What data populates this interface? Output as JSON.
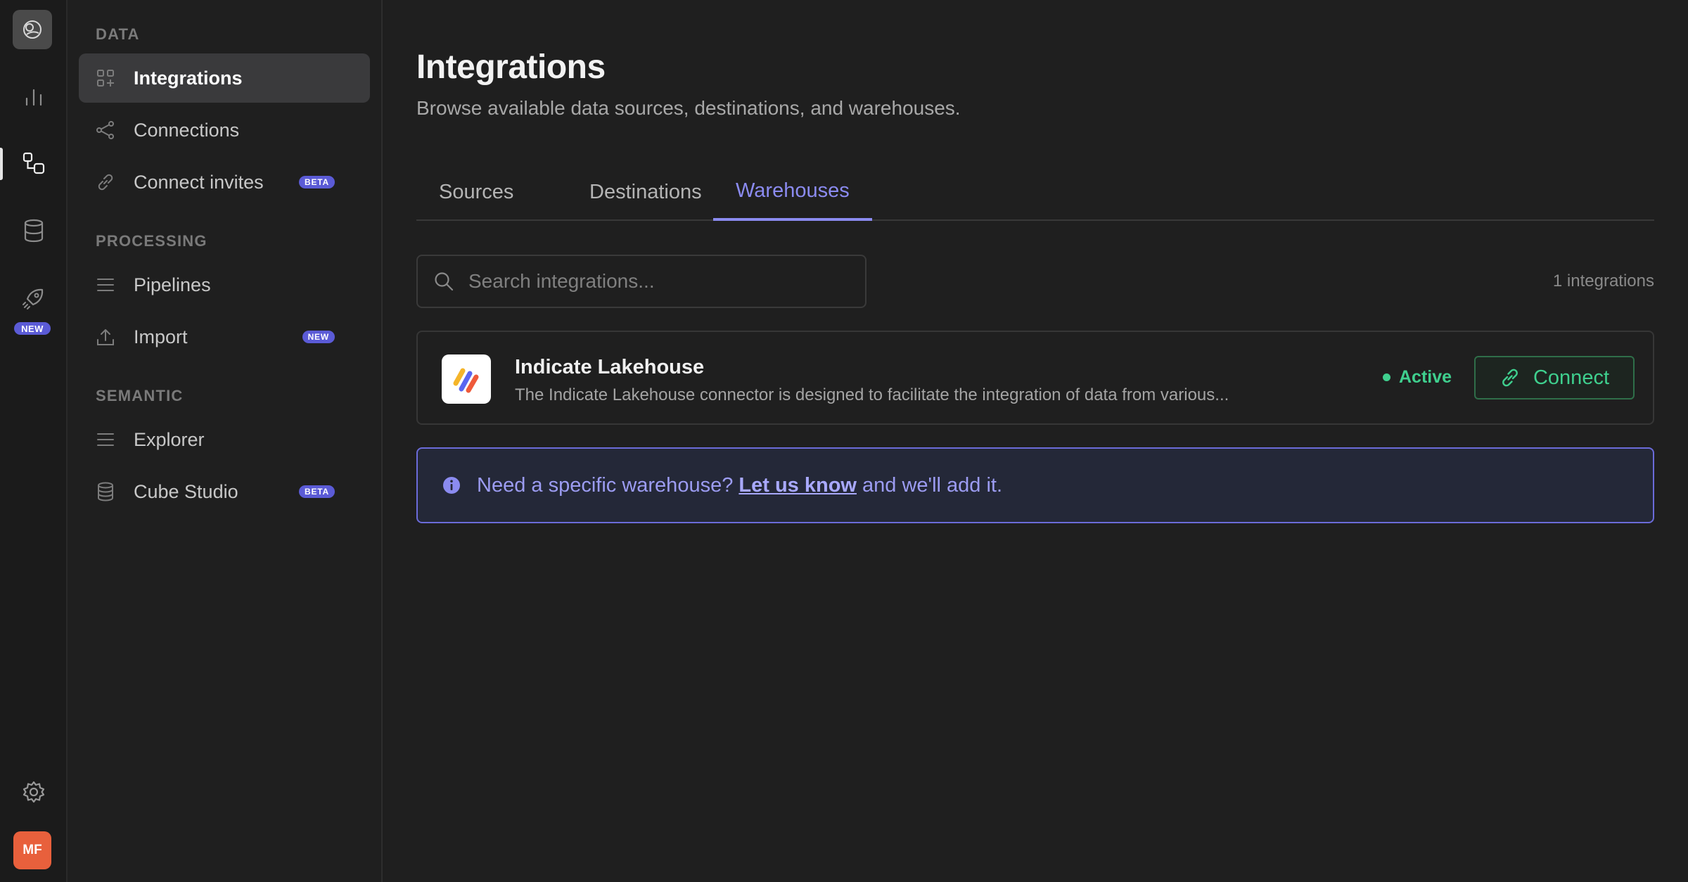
{
  "rail": {
    "new_badge": "NEW",
    "avatar_initials": "MF",
    "icons": [
      "app-logo-icon",
      "bar-chart-icon",
      "integrations-icon",
      "database-icon",
      "rocket-icon",
      "gear-icon"
    ]
  },
  "sidebar": {
    "sections": [
      {
        "label": "DATA",
        "items": [
          {
            "label": "Integrations",
            "icon": "grid-plus-icon",
            "active": true
          },
          {
            "label": "Connections",
            "icon": "share-nodes-icon"
          },
          {
            "label": "Connect invites",
            "icon": "link-icon",
            "badge": "BETA"
          }
        ]
      },
      {
        "label": "PROCESSING",
        "items": [
          {
            "label": "Pipelines",
            "icon": "lines-icon"
          },
          {
            "label": "Import",
            "icon": "upload-icon",
            "badge": "NEW"
          }
        ]
      },
      {
        "label": "SEMANTIC",
        "items": [
          {
            "label": "Explorer",
            "icon": "lines-icon"
          },
          {
            "label": "Cube Studio",
            "icon": "database-icon",
            "badge": "BETA"
          }
        ]
      }
    ]
  },
  "main": {
    "title": "Integrations",
    "subtitle": "Browse available data sources, destinations, and warehouses.",
    "tabs": [
      {
        "label": "Sources"
      },
      {
        "label": "Destinations"
      },
      {
        "label": "Warehouses",
        "active": true
      }
    ],
    "search": {
      "placeholder": "Search integrations...",
      "value": ""
    },
    "count_text": "1 integrations",
    "integration": {
      "name": "Indicate Lakehouse",
      "description": "The Indicate Lakehouse connector is designed to facilitate the integration of data from various...",
      "status": "Active",
      "action_label": "Connect"
    },
    "notice": {
      "prefix": "Need a specific warehouse?",
      "link": "Let us know",
      "suffix": "and we'll add it."
    }
  },
  "colors": {
    "accent": "#8b8bf0",
    "success": "#3fcf8e",
    "badge": "#5b5bd6",
    "avatar": "#e8603c"
  }
}
